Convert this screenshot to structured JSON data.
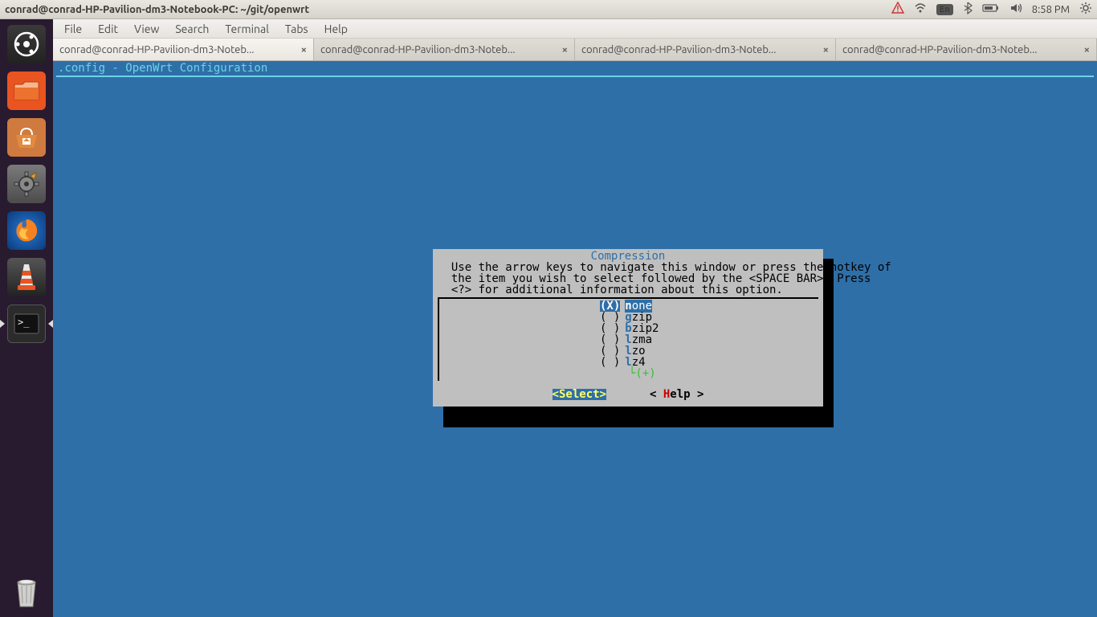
{
  "topbar": {
    "title": "conrad@conrad-HP-Pavilion-dm3-Notebook-PC: ~/git/openwrt",
    "lang": "En",
    "time": "8:58 PM"
  },
  "menubar": [
    "File",
    "Edit",
    "View",
    "Search",
    "Terminal",
    "Tabs",
    "Help"
  ],
  "tabs": [
    {
      "label": "conrad@conrad-HP-Pavilion-dm3-Noteb...",
      "active": true
    },
    {
      "label": "conrad@conrad-HP-Pavilion-dm3-Noteb...",
      "active": false
    },
    {
      "label": "conrad@conrad-HP-Pavilion-dm3-Noteb...",
      "active": false
    },
    {
      "label": "conrad@conrad-HP-Pavilion-dm3-Noteb...",
      "active": false
    }
  ],
  "terminal": {
    "header": ".config - OpenWrt Configuration"
  },
  "dialog": {
    "title": "Compression",
    "help_line1": "  Use the arrow keys to navigate this window or press the hotkey of",
    "help_line2": "  the item you wish to select followed by the <SPACE BAR>. Press",
    "help_line3": "  <?> for additional information about this option.",
    "options": [
      {
        "mark": "(X)",
        "hot": "n",
        "rest": "one",
        "selected": true
      },
      {
        "mark": "( )",
        "hot": "g",
        "rest": "zip",
        "selected": false
      },
      {
        "mark": "( )",
        "hot": "b",
        "rest": "zip2",
        "selected": false
      },
      {
        "mark": "( )",
        "hot": "l",
        "rest": "zma",
        "selected": false
      },
      {
        "mark": "( )",
        "hot": "l",
        "rest": "zo",
        "selected": false
      },
      {
        "mark": "( )",
        "hot": "l",
        "rest": "z4",
        "selected": false
      }
    ],
    "more": "└(+)",
    "btn_select": "<Select>",
    "btn_help_pre": "< ",
    "btn_help_hot": "H",
    "btn_help_post": "elp >"
  },
  "launcher": [
    {
      "name": "dash",
      "bg": "#333",
      "running": false
    },
    {
      "name": "files",
      "bg": "#e95420",
      "running": false
    },
    {
      "name": "software",
      "bg": "#d47a3c",
      "running": false
    },
    {
      "name": "settings",
      "bg": "#6b6b6b",
      "running": false
    },
    {
      "name": "firefox",
      "bg": "#1a66b8",
      "running": false
    },
    {
      "name": "vlc",
      "bg": "#444",
      "running": false
    },
    {
      "name": "terminal",
      "bg": "#2c2c2c",
      "running": true,
      "active": true
    }
  ],
  "launcher_bottom": {
    "name": "trash"
  }
}
